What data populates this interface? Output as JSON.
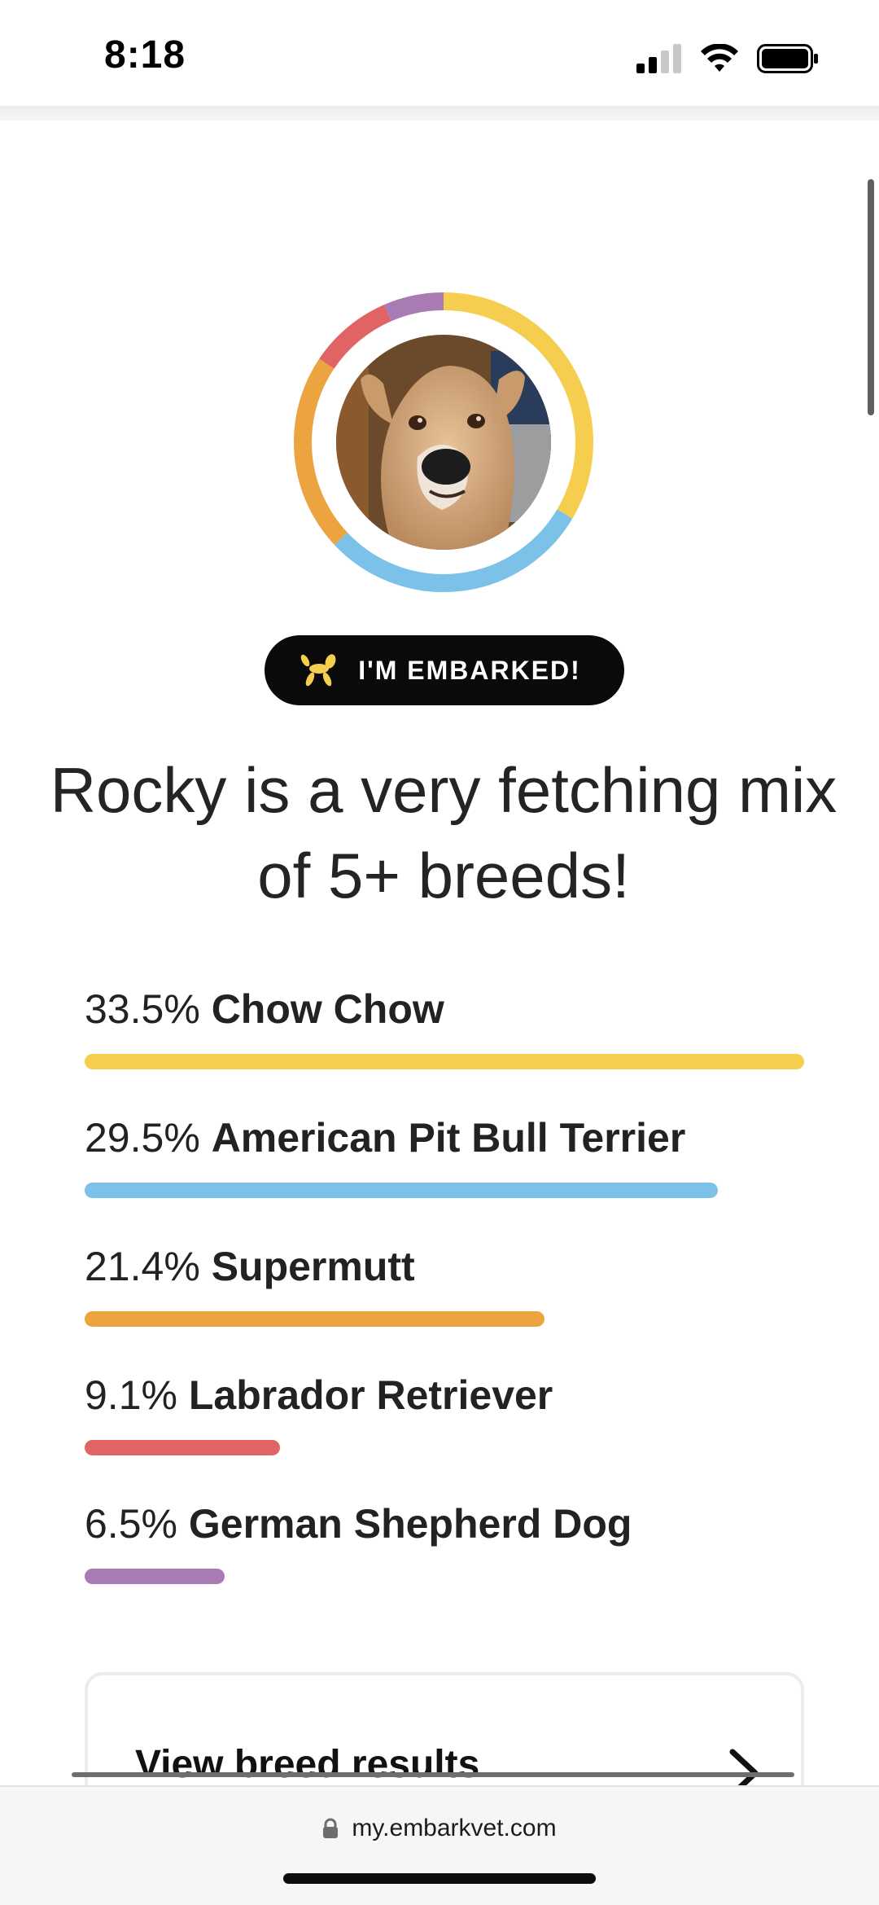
{
  "status_bar": {
    "time": "8:18"
  },
  "profile": {
    "ring_colors": [
      "#F5CE4F",
      "#7BC1E8",
      "#EBA440",
      "#E06464",
      "#A87BB4"
    ],
    "badge_label": "I'M EMBARKED!",
    "badge_icon": "balloon-dog-icon",
    "badge_icon_color": "#F5CE4F",
    "headline": "Rocky is a very fetching mix of 5+ breeds!"
  },
  "breeds": [
    {
      "percent": "33.5%",
      "name": "Chow Chow",
      "value": 33.5,
      "color": "#F5CE4F"
    },
    {
      "percent": "29.5%",
      "name": "American Pit Bull Terrier",
      "value": 29.5,
      "color": "#7BC1E8"
    },
    {
      "percent": "21.4%",
      "name": "Supermutt",
      "value": 21.4,
      "color": "#EBA440"
    },
    {
      "percent": "9.1%",
      "name": "Labrador Retriever",
      "value": 9.1,
      "color": "#E06464"
    },
    {
      "percent": "6.5%",
      "name": "German Shepherd Dog",
      "value": 6.5,
      "color": "#A87BB4"
    }
  ],
  "results_card": {
    "label": "View breed results",
    "icon": "chevron-right-icon"
  },
  "browser": {
    "url": "my.embarkvet.com",
    "lock_icon": "lock-icon"
  }
}
